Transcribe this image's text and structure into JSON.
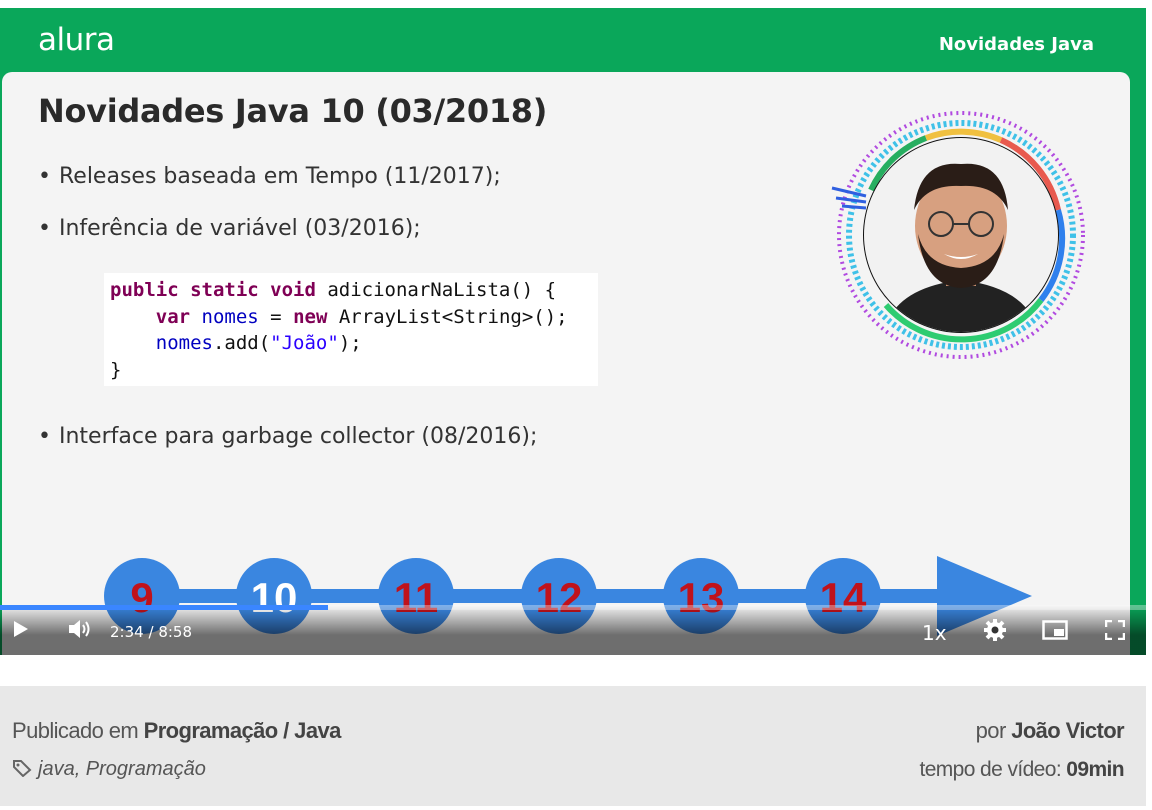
{
  "slide": {
    "logo": "alura",
    "course_name": "Novidades Java",
    "title": "Novidades Java 10 (03/2018)",
    "bullets": [
      "Releases baseada em Tempo (11/2017);",
      "Inferência de variável (03/2016);",
      "Interface para garbage collector (08/2016);"
    ],
    "code": {
      "line1_kw": "public static void",
      "line1_rest": " adicionarNaLista() {",
      "line2_kw1": "var",
      "line2_var": " nomes",
      "line2_eq": " = ",
      "line2_kw2": "new",
      "line2_rest": " ArrayList<String>();",
      "line3_var": "nomes",
      "line3_mid": ".add(",
      "line3_str": "\"João\"",
      "line3_end": ");",
      "line4": "}"
    },
    "timeline": [
      "9",
      "10",
      "11",
      "12",
      "13",
      "14"
    ],
    "colors": {
      "brand": "#0aa75a",
      "timeline": "#3a86e0",
      "timeline_text": "#c0121b"
    }
  },
  "player": {
    "current_time": "2:34",
    "separator": "/",
    "duration": "8:58",
    "progress": 0.286,
    "speed": "1x",
    "icons": [
      "play-icon",
      "volume-icon",
      "settings-icon",
      "pip-icon",
      "fullscreen-icon"
    ]
  },
  "info": {
    "published_prefix": "Publicado em ",
    "category": "Programação / Java",
    "author_prefix": "por ",
    "author": "João Victor",
    "tags": "java, Programação",
    "duration_prefix": "tempo de vídeo: ",
    "duration": "09min"
  }
}
